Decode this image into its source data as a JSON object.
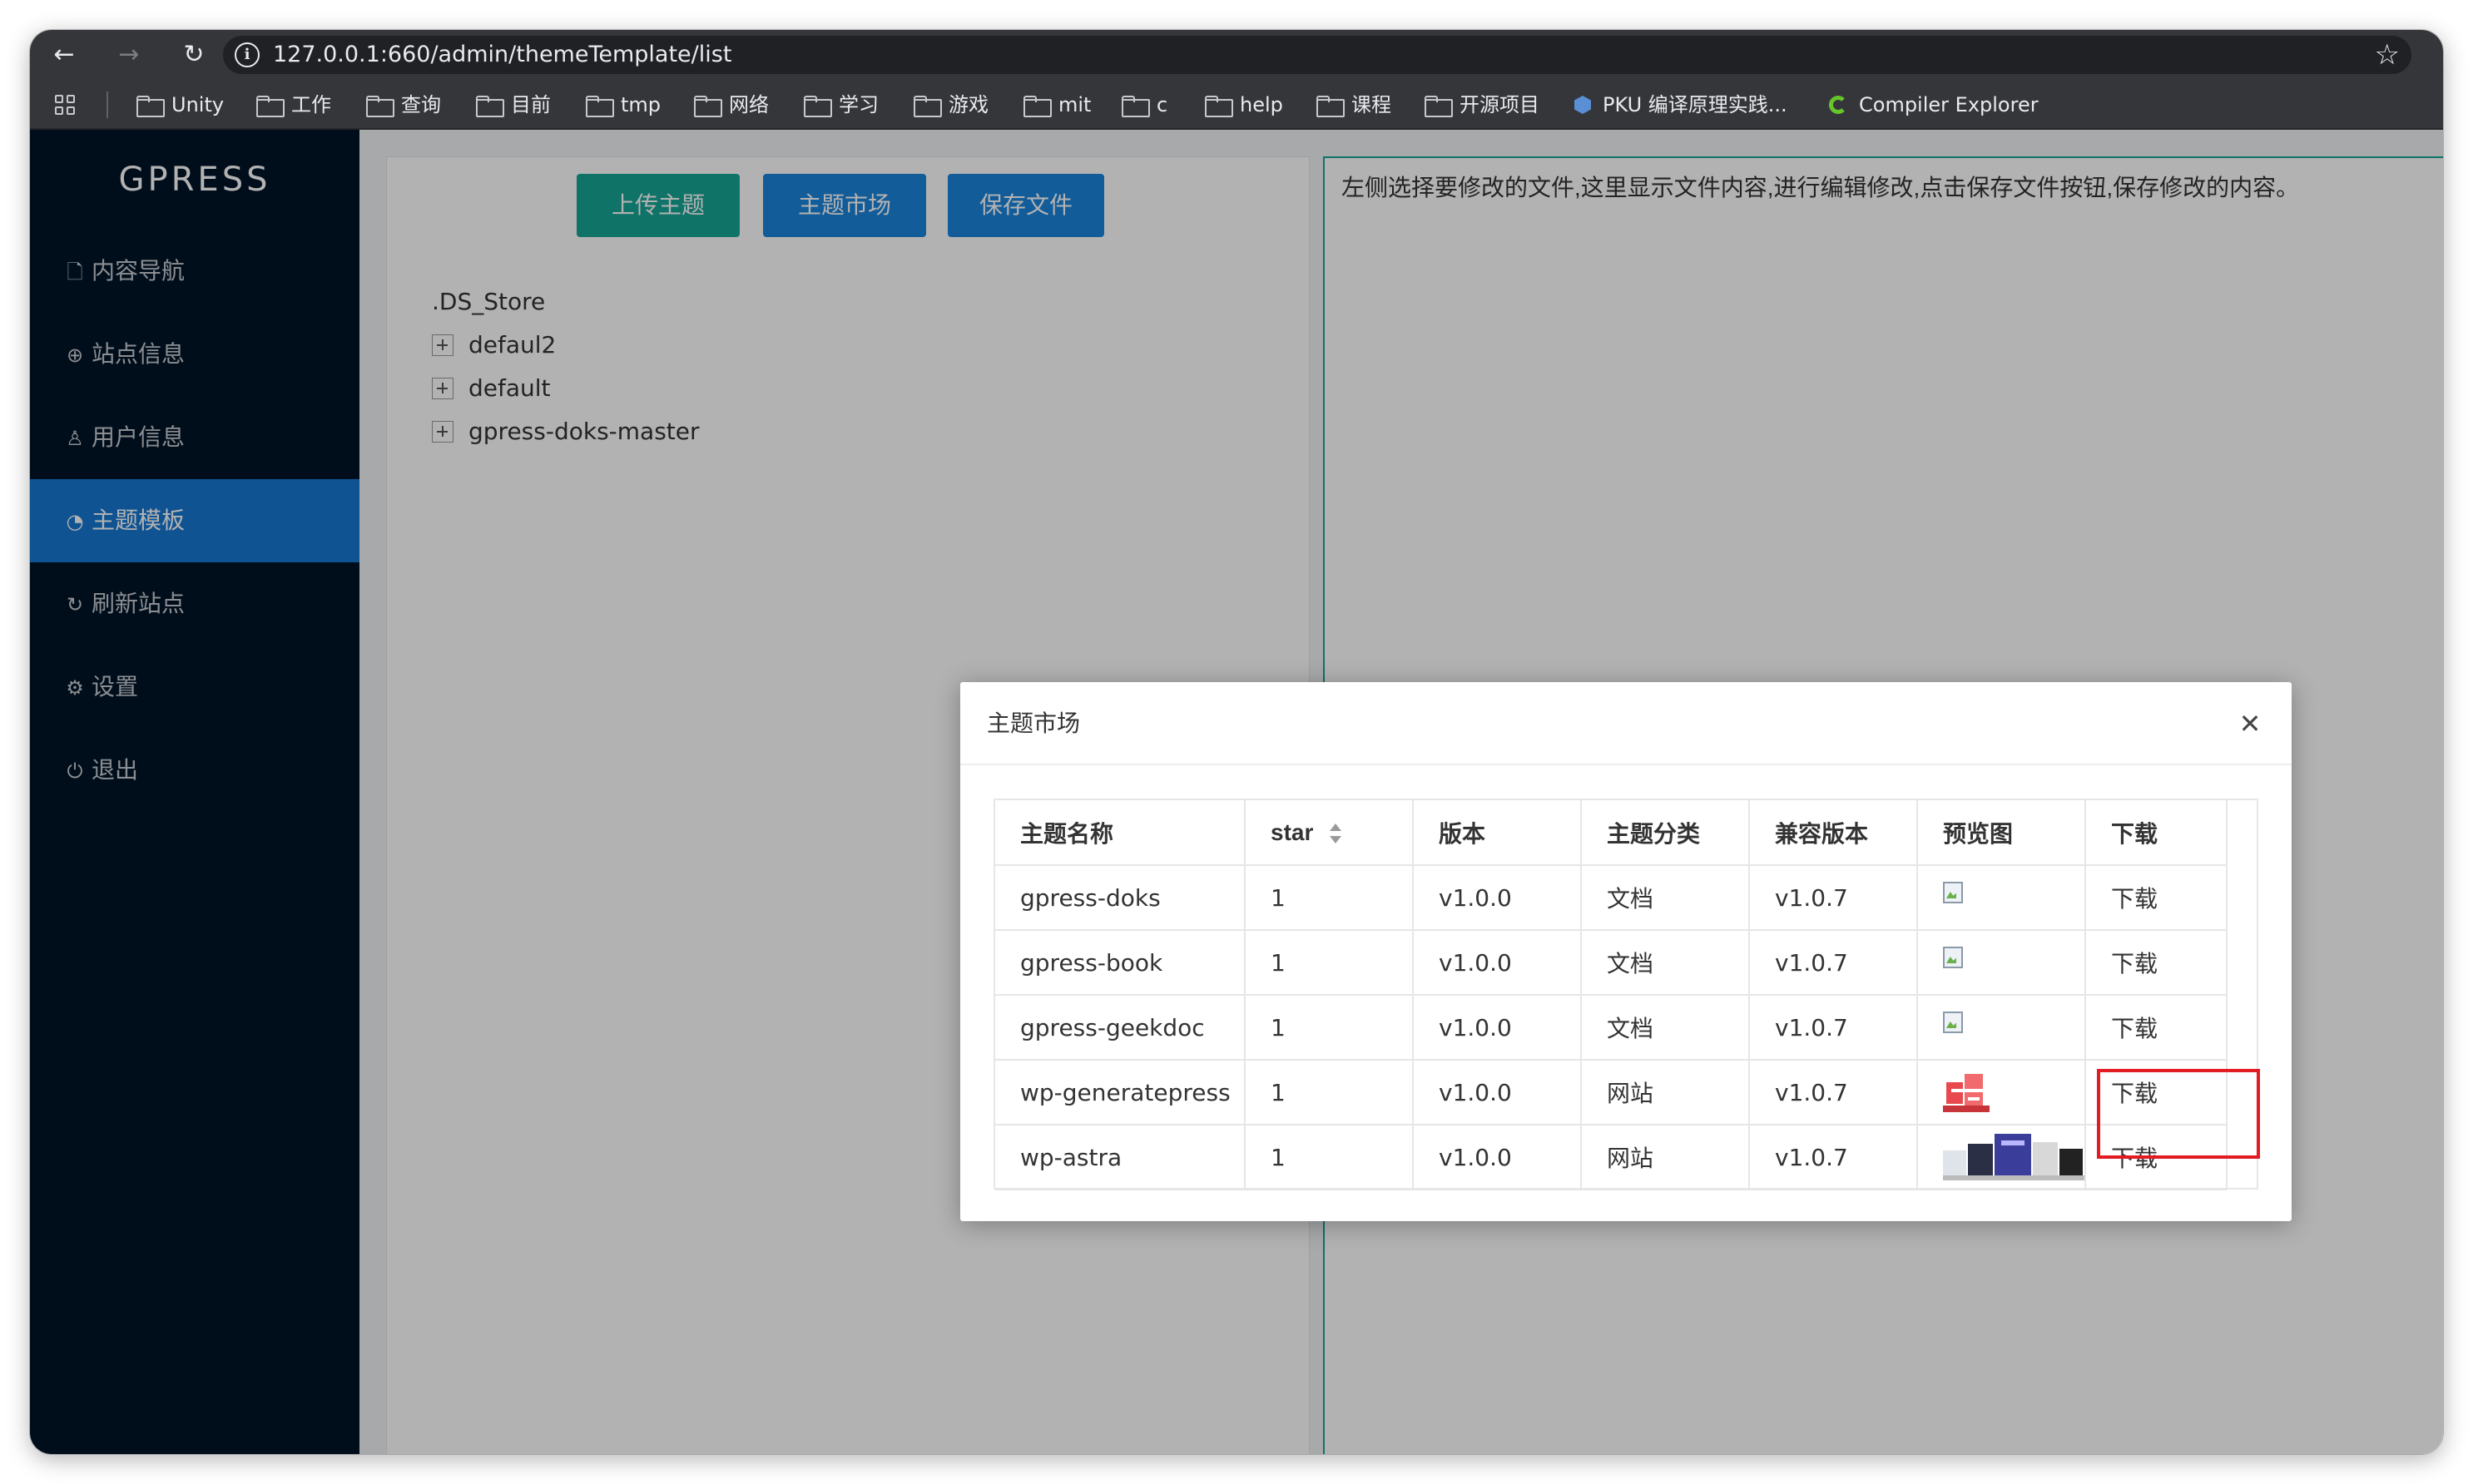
{
  "browser": {
    "url": "127.0.0.1:660/admin/themeTemplate/list",
    "bookmarks": [
      "Unity",
      "工作",
      "查询",
      "目前",
      "tmp",
      "网络",
      "学习",
      "游戏",
      "mit",
      "c",
      "help",
      "课程",
      "开源项目",
      "PKU 编译原理实践...",
      "Compiler Explorer"
    ]
  },
  "sidebar": {
    "logo": "GPRESS",
    "items": [
      {
        "label": "内容导航",
        "icon": "file-icon"
      },
      {
        "label": "站点信息",
        "icon": "globe-icon"
      },
      {
        "label": "用户信息",
        "icon": "user-icon"
      },
      {
        "label": "主题模板",
        "icon": "palette-icon",
        "active": true
      },
      {
        "label": "刷新站点",
        "icon": "refresh-icon"
      },
      {
        "label": "设置",
        "icon": "gear-icon"
      },
      {
        "label": "退出",
        "icon": "power-icon"
      }
    ]
  },
  "toolbar": {
    "upload_label": "上传主题",
    "market_label": "主题市场",
    "save_label": "保存文件"
  },
  "file_tree": [
    {
      "name": ".DS_Store",
      "expandable": false
    },
    {
      "name": "defaul2",
      "expandable": true
    },
    {
      "name": "default",
      "expandable": true
    },
    {
      "name": "gpress-doks-master",
      "expandable": true
    }
  ],
  "editor": {
    "hint": "左侧选择要修改的文件,这里显示文件内容,进行编辑修改,点击保存文件按钮,保存修改的内容。"
  },
  "modal": {
    "title": "主题市场",
    "columns": [
      "主题名称",
      "star",
      "版本",
      "主题分类",
      "兼容版本",
      "预览图",
      "下载"
    ],
    "rows": [
      {
        "name": "gpress-doks",
        "star": "1",
        "version": "v1.0.0",
        "category": "文档",
        "compat": "v1.0.7",
        "preview": "broken-image-icon",
        "download": "下载"
      },
      {
        "name": "gpress-book",
        "star": "1",
        "version": "v1.0.0",
        "category": "文档",
        "compat": "v1.0.7",
        "preview": "broken-image-icon",
        "download": "下载"
      },
      {
        "name": "gpress-geekdoc",
        "star": "1",
        "version": "v1.0.0",
        "category": "文档",
        "compat": "v1.0.7",
        "preview": "broken-image-icon",
        "download": "下载"
      },
      {
        "name": "wp-generatepress",
        "star": "1",
        "version": "v1.0.0",
        "category": "网站",
        "compat": "v1.0.7",
        "preview": "generatepress-thumbnail",
        "download": "下载"
      },
      {
        "name": "wp-astra",
        "star": "1",
        "version": "v1.0.0",
        "category": "网站",
        "compat": "v1.0.7",
        "preview": "astra-thumbnail",
        "download": "下载"
      }
    ]
  },
  "colors": {
    "sidebar_bg": "#001529",
    "active_menu": "#1677d2",
    "upload_button": "#16a596",
    "blue_button": "#1a84dc",
    "highlight_box": "#e31b23"
  }
}
